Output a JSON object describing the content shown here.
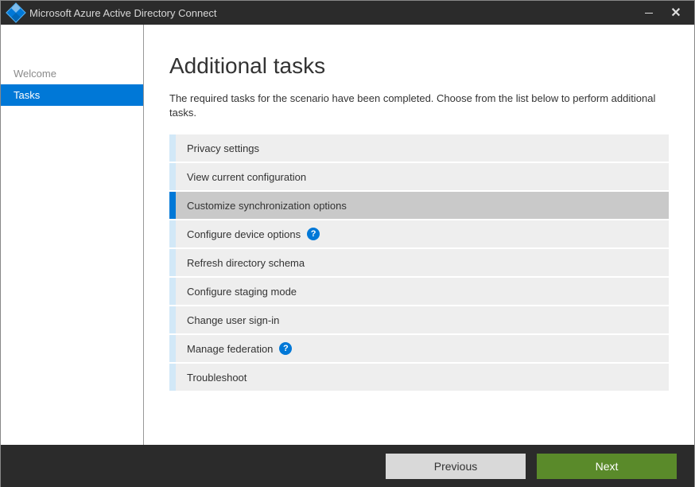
{
  "window": {
    "title": "Microsoft Azure Active Directory Connect"
  },
  "sidebar": {
    "items": [
      {
        "label": "Welcome",
        "active": false
      },
      {
        "label": "Tasks",
        "active": true
      }
    ]
  },
  "main": {
    "title": "Additional tasks",
    "description": "The required tasks for the scenario have been completed. Choose from the list below to perform additional tasks.",
    "tasks": [
      {
        "label": "Privacy settings",
        "selected": false,
        "help": false
      },
      {
        "label": "View current configuration",
        "selected": false,
        "help": false
      },
      {
        "label": "Customize synchronization options",
        "selected": true,
        "help": false
      },
      {
        "label": "Configure device options",
        "selected": false,
        "help": true
      },
      {
        "label": "Refresh directory schema",
        "selected": false,
        "help": false
      },
      {
        "label": "Configure staging mode",
        "selected": false,
        "help": false
      },
      {
        "label": "Change user sign-in",
        "selected": false,
        "help": false
      },
      {
        "label": "Manage federation",
        "selected": false,
        "help": true
      },
      {
        "label": "Troubleshoot",
        "selected": false,
        "help": false
      }
    ]
  },
  "footer": {
    "previous": "Previous",
    "next": "Next"
  },
  "icons": {
    "help": "?"
  }
}
